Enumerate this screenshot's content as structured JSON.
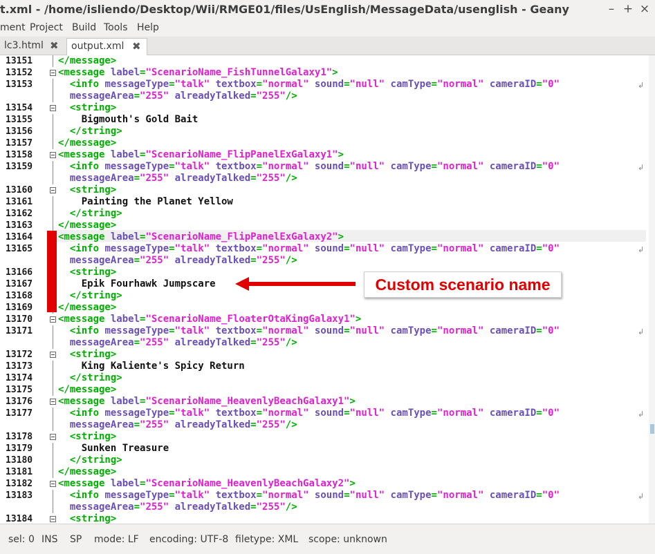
{
  "window": {
    "title": "t.xml - /home/isliendo/Desktop/Wii/RMGE01/files/UsEnglish/MessageData/usenglish - Geany",
    "minimize": "–",
    "maximize": "+",
    "close": "×"
  },
  "menu": [
    "ment",
    "Project",
    "Build",
    "Tools",
    "Help"
  ],
  "tabs": [
    {
      "label": "lc3.html",
      "close": "✖"
    },
    {
      "label": "output.xml",
      "close": "✖"
    }
  ],
  "editor": {
    "lines": [
      {
        "n": "13151",
        "parts": [
          [
            "tag",
            "</message>"
          ]
        ]
      },
      {
        "n": "13152",
        "parts": [
          [
            "tag",
            "<message "
          ],
          [
            "attr",
            "label"
          ],
          [
            "tag",
            "="
          ],
          [
            "val",
            "\"ScenarioName_FishTunnelGalaxy1\""
          ],
          [
            "tag",
            ">"
          ]
        ]
      },
      {
        "n": "13153",
        "parts": [
          [
            "tag",
            "  <info "
          ],
          [
            "attr",
            "messageType"
          ],
          [
            "tag",
            "="
          ],
          [
            "val",
            "\"talk\" "
          ],
          [
            "attr",
            "textbox"
          ],
          [
            "tag",
            "="
          ],
          [
            "val",
            "\"normal\" "
          ],
          [
            "attr",
            "sound"
          ],
          [
            "tag",
            "="
          ],
          [
            "val",
            "\"null\" "
          ],
          [
            "attr",
            "camType"
          ],
          [
            "tag",
            "="
          ],
          [
            "val",
            "\"normal\" "
          ],
          [
            "attr",
            "cameraID"
          ],
          [
            "tag",
            "="
          ],
          [
            "val",
            "\"0\""
          ]
        ]
      },
      {
        "n": "",
        "parts": [
          [
            "attr",
            "  messageArea"
          ],
          [
            "tag",
            "="
          ],
          [
            "val",
            "\"255\" "
          ],
          [
            "attr",
            "alreadyTalked"
          ],
          [
            "tag",
            "="
          ],
          [
            "val",
            "\"255\""
          ],
          [
            "tag",
            "/>"
          ]
        ]
      },
      {
        "n": "13154",
        "parts": [
          [
            "tag",
            "  <string>"
          ]
        ]
      },
      {
        "n": "13155",
        "parts": [
          [
            "txt",
            "    Bigmouth's Gold Bait"
          ]
        ]
      },
      {
        "n": "13156",
        "parts": [
          [
            "tag",
            "  </string>"
          ]
        ]
      },
      {
        "n": "13157",
        "parts": [
          [
            "tag",
            "</message>"
          ]
        ]
      },
      {
        "n": "13158",
        "parts": [
          [
            "tag",
            "<message "
          ],
          [
            "attr",
            "label"
          ],
          [
            "tag",
            "="
          ],
          [
            "val",
            "\"ScenarioName_FlipPanelExGalaxy1\""
          ],
          [
            "tag",
            ">"
          ]
        ]
      },
      {
        "n": "13159",
        "parts": [
          [
            "tag",
            "  <info "
          ],
          [
            "attr",
            "messageType"
          ],
          [
            "tag",
            "="
          ],
          [
            "val",
            "\"talk\" "
          ],
          [
            "attr",
            "textbox"
          ],
          [
            "tag",
            "="
          ],
          [
            "val",
            "\"normal\" "
          ],
          [
            "attr",
            "sound"
          ],
          [
            "tag",
            "="
          ],
          [
            "val",
            "\"null\" "
          ],
          [
            "attr",
            "camType"
          ],
          [
            "tag",
            "="
          ],
          [
            "val",
            "\"normal\" "
          ],
          [
            "attr",
            "cameraID"
          ],
          [
            "tag",
            "="
          ],
          [
            "val",
            "\"0\""
          ]
        ]
      },
      {
        "n": "",
        "parts": [
          [
            "attr",
            "  messageArea"
          ],
          [
            "tag",
            "="
          ],
          [
            "val",
            "\"255\" "
          ],
          [
            "attr",
            "alreadyTalked"
          ],
          [
            "tag",
            "="
          ],
          [
            "val",
            "\"255\""
          ],
          [
            "tag",
            "/>"
          ]
        ]
      },
      {
        "n": "13160",
        "parts": [
          [
            "tag",
            "  <string>"
          ]
        ]
      },
      {
        "n": "13161",
        "parts": [
          [
            "txt",
            "    Painting the Planet Yellow"
          ]
        ]
      },
      {
        "n": "13162",
        "parts": [
          [
            "tag",
            "  </string>"
          ]
        ]
      },
      {
        "n": "13163",
        "parts": [
          [
            "tag",
            "</message>"
          ]
        ]
      },
      {
        "n": "13164",
        "parts": [
          [
            "tag",
            "<message "
          ],
          [
            "attr",
            "label"
          ],
          [
            "tag",
            "="
          ],
          [
            "val",
            "\"ScenarioName_FlipPanelExGalaxy2\""
          ],
          [
            "tag",
            ">"
          ]
        ]
      },
      {
        "n": "13165",
        "parts": [
          [
            "tag",
            "  <info "
          ],
          [
            "attr",
            "messageType"
          ],
          [
            "tag",
            "="
          ],
          [
            "val",
            "\"talk\" "
          ],
          [
            "attr",
            "textbox"
          ],
          [
            "tag",
            "="
          ],
          [
            "val",
            "\"normal\" "
          ],
          [
            "attr",
            "sound"
          ],
          [
            "tag",
            "="
          ],
          [
            "val",
            "\"null\" "
          ],
          [
            "attr",
            "camType"
          ],
          [
            "tag",
            "="
          ],
          [
            "val",
            "\"normal\" "
          ],
          [
            "attr",
            "cameraID"
          ],
          [
            "tag",
            "="
          ],
          [
            "val",
            "\"0\""
          ]
        ]
      },
      {
        "n": "",
        "parts": [
          [
            "attr",
            "  messageArea"
          ],
          [
            "tag",
            "="
          ],
          [
            "val",
            "\"255\" "
          ],
          [
            "attr",
            "alreadyTalked"
          ],
          [
            "tag",
            "="
          ],
          [
            "val",
            "\"255\""
          ],
          [
            "tag",
            "/>"
          ]
        ]
      },
      {
        "n": "13166",
        "parts": [
          [
            "tag",
            "  <string>"
          ]
        ]
      },
      {
        "n": "13167",
        "parts": [
          [
            "txt",
            "    Epik Fourhawk Jumpscare"
          ]
        ]
      },
      {
        "n": "13168",
        "parts": [
          [
            "tag",
            "  </string>"
          ]
        ]
      },
      {
        "n": "13169",
        "parts": [
          [
            "tag",
            "</message>"
          ]
        ]
      },
      {
        "n": "13170",
        "parts": [
          [
            "tag",
            "<message "
          ],
          [
            "attr",
            "label"
          ],
          [
            "tag",
            "="
          ],
          [
            "val",
            "\"ScenarioName_FloaterOtaKingGalaxy1\""
          ],
          [
            "tag",
            ">"
          ]
        ]
      },
      {
        "n": "13171",
        "parts": [
          [
            "tag",
            "  <info "
          ],
          [
            "attr",
            "messageType"
          ],
          [
            "tag",
            "="
          ],
          [
            "val",
            "\"talk\" "
          ],
          [
            "attr",
            "textbox"
          ],
          [
            "tag",
            "="
          ],
          [
            "val",
            "\"normal\" "
          ],
          [
            "attr",
            "sound"
          ],
          [
            "tag",
            "="
          ],
          [
            "val",
            "\"null\" "
          ],
          [
            "attr",
            "camType"
          ],
          [
            "tag",
            "="
          ],
          [
            "val",
            "\"normal\" "
          ],
          [
            "attr",
            "cameraID"
          ],
          [
            "tag",
            "="
          ],
          [
            "val",
            "\"0\""
          ]
        ]
      },
      {
        "n": "",
        "parts": [
          [
            "attr",
            "  messageArea"
          ],
          [
            "tag",
            "="
          ],
          [
            "val",
            "\"255\" "
          ],
          [
            "attr",
            "alreadyTalked"
          ],
          [
            "tag",
            "="
          ],
          [
            "val",
            "\"255\""
          ],
          [
            "tag",
            "/>"
          ]
        ]
      },
      {
        "n": "13172",
        "parts": [
          [
            "tag",
            "  <string>"
          ]
        ]
      },
      {
        "n": "13173",
        "parts": [
          [
            "txt",
            "    King Kaliente's Spicy Return"
          ]
        ]
      },
      {
        "n": "13174",
        "parts": [
          [
            "tag",
            "  </string>"
          ]
        ]
      },
      {
        "n": "13175",
        "parts": [
          [
            "tag",
            "</message>"
          ]
        ]
      },
      {
        "n": "13176",
        "parts": [
          [
            "tag",
            "<message "
          ],
          [
            "attr",
            "label"
          ],
          [
            "tag",
            "="
          ],
          [
            "val",
            "\"ScenarioName_HeavenlyBeachGalaxy1\""
          ],
          [
            "tag",
            ">"
          ]
        ]
      },
      {
        "n": "13177",
        "parts": [
          [
            "tag",
            "  <info "
          ],
          [
            "attr",
            "messageType"
          ],
          [
            "tag",
            "="
          ],
          [
            "val",
            "\"talk\" "
          ],
          [
            "attr",
            "textbox"
          ],
          [
            "tag",
            "="
          ],
          [
            "val",
            "\"normal\" "
          ],
          [
            "attr",
            "sound"
          ],
          [
            "tag",
            "="
          ],
          [
            "val",
            "\"null\" "
          ],
          [
            "attr",
            "camType"
          ],
          [
            "tag",
            "="
          ],
          [
            "val",
            "\"normal\" "
          ],
          [
            "attr",
            "cameraID"
          ],
          [
            "tag",
            "="
          ],
          [
            "val",
            "\"0\""
          ]
        ]
      },
      {
        "n": "",
        "parts": [
          [
            "attr",
            "  messageArea"
          ],
          [
            "tag",
            "="
          ],
          [
            "val",
            "\"255\" "
          ],
          [
            "attr",
            "alreadyTalked"
          ],
          [
            "tag",
            "="
          ],
          [
            "val",
            "\"255\""
          ],
          [
            "tag",
            "/>"
          ]
        ]
      },
      {
        "n": "13178",
        "parts": [
          [
            "tag",
            "  <string>"
          ]
        ]
      },
      {
        "n": "13179",
        "parts": [
          [
            "txt",
            "    Sunken Treasure"
          ]
        ]
      },
      {
        "n": "13180",
        "parts": [
          [
            "tag",
            "  </string>"
          ]
        ]
      },
      {
        "n": "13181",
        "parts": [
          [
            "tag",
            "</message>"
          ]
        ]
      },
      {
        "n": "13182",
        "parts": [
          [
            "tag",
            "<message "
          ],
          [
            "attr",
            "label"
          ],
          [
            "tag",
            "="
          ],
          [
            "val",
            "\"ScenarioName_HeavenlyBeachGalaxy2\""
          ],
          [
            "tag",
            ">"
          ]
        ]
      },
      {
        "n": "13183",
        "parts": [
          [
            "tag",
            "  <info "
          ],
          [
            "attr",
            "messageType"
          ],
          [
            "tag",
            "="
          ],
          [
            "val",
            "\"talk\" "
          ],
          [
            "attr",
            "textbox"
          ],
          [
            "tag",
            "="
          ],
          [
            "val",
            "\"normal\" "
          ],
          [
            "attr",
            "sound"
          ],
          [
            "tag",
            "="
          ],
          [
            "val",
            "\"null\" "
          ],
          [
            "attr",
            "camType"
          ],
          [
            "tag",
            "="
          ],
          [
            "val",
            "\"normal\" "
          ],
          [
            "attr",
            "cameraID"
          ],
          [
            "tag",
            "="
          ],
          [
            "val",
            "\"0\""
          ]
        ]
      },
      {
        "n": "",
        "parts": [
          [
            "attr",
            "  messageArea"
          ],
          [
            "tag",
            "="
          ],
          [
            "val",
            "\"255\" "
          ],
          [
            "attr",
            "alreadyTalked"
          ],
          [
            "tag",
            "="
          ],
          [
            "val",
            "\"255\""
          ],
          [
            "tag",
            "/>"
          ]
        ]
      },
      {
        "n": "13184",
        "parts": [
          [
            "tag",
            "  <string>"
          ]
        ]
      }
    ]
  },
  "annotation": {
    "label": "Custom scenario name",
    "color": "#e00000"
  },
  "status": {
    "sel": "sel: 0",
    "ins": "INS",
    "sp": "SP",
    "mode": "mode: LF",
    "encoding": "encoding: UTF-8",
    "filetype": "filetype: XML",
    "scope": "scope: unknown"
  }
}
